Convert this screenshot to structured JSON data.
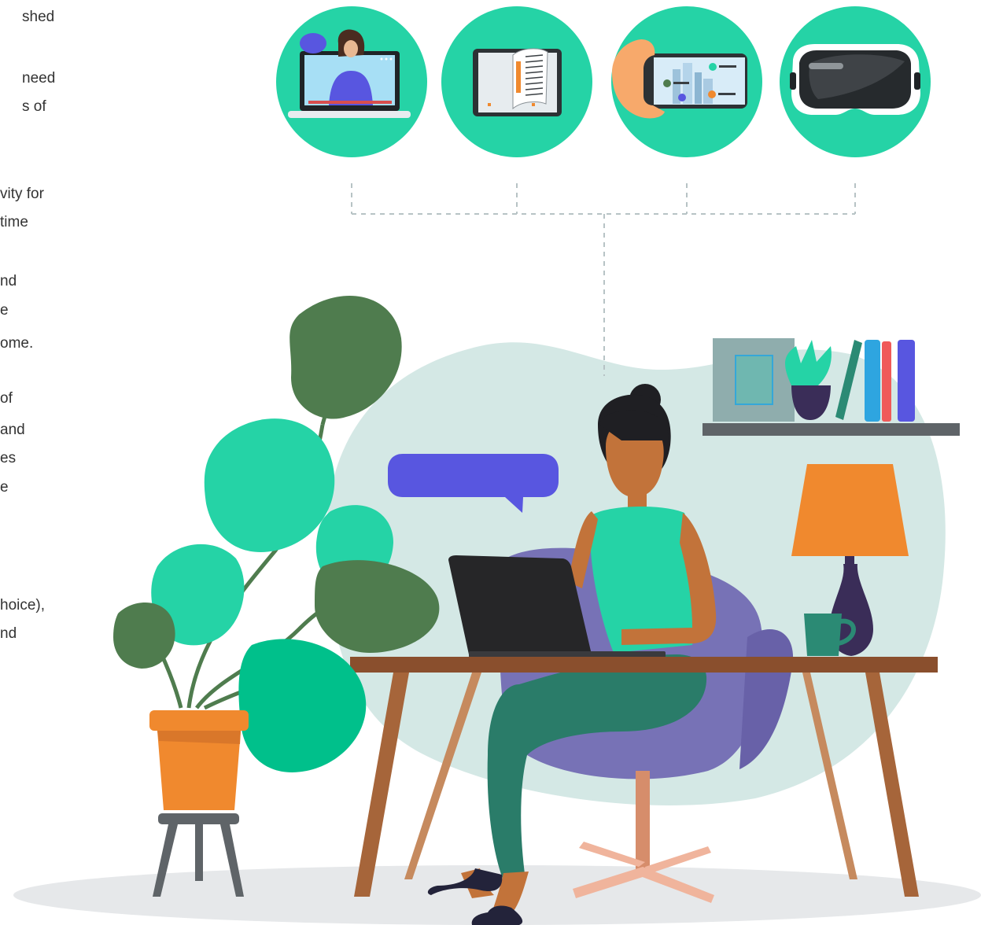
{
  "text_fragments": [
    "shed",
    "need",
    "s of",
    "vity for",
    "time",
    "nd",
    "e",
    "ome.",
    "of",
    "and",
    "es",
    "e",
    "hoice),",
    "nd"
  ],
  "palette": {
    "accent_green": "#25d3a6",
    "backdrop_blob": "#d4e8e5",
    "chair_purple": "#7772b6",
    "lamp_orange": "#f0892e",
    "leaf_dark": "#4f7c4e",
    "speech_bubble": "#5856e0",
    "floor_shadow": "#e6e8ea"
  },
  "icons": {
    "video_lesson": "video-lesson-icon",
    "ebook": "ebook-tablet-icon",
    "phone_ar": "phone-ar-icon",
    "vr_headset": "vr-headset-icon"
  }
}
